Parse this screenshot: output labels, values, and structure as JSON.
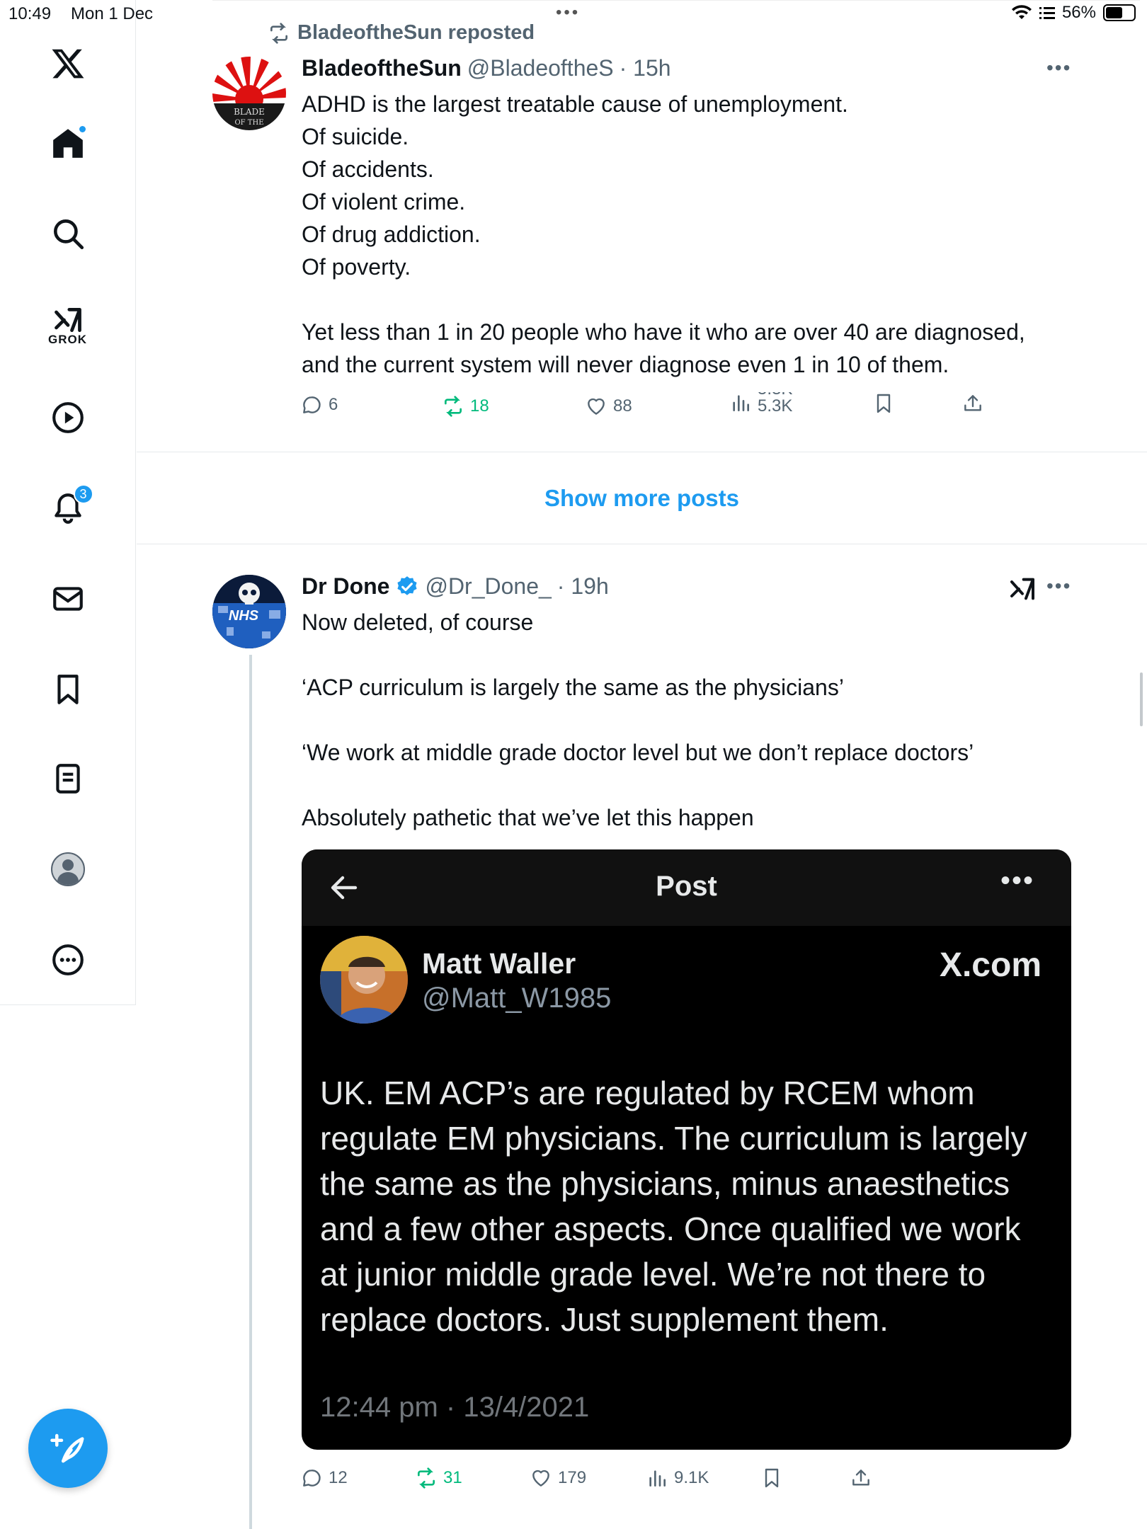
{
  "status_bar": {
    "time": "10:49",
    "date": "Mon 1 Dec",
    "battery": "56%"
  },
  "sidebar": {
    "grok_label": "GROK",
    "notifications_count": "3"
  },
  "post1": {
    "repost_label": "BladeoftheSun reposted",
    "name": "BladeoftheSun",
    "handle": "@BladeoftheS",
    "time": "· 15h",
    "lines": [
      "ADHD is the largest treatable cause of unemployment.",
      "Of suicide.",
      "Of accidents.",
      "Of violent crime.",
      "Of drug addiction.",
      "Of poverty.",
      "",
      "Yet less than 1 in 20 people who have it who are over 40 are diagnosed,",
      "and the current system will never diagnose even 1 in 10 of them."
    ],
    "replies": "6",
    "reposts": "18",
    "likes": "88",
    "views_old": "5.3K",
    "views_new": "5.3K"
  },
  "show_more": "Show more posts",
  "post2": {
    "name": "Dr Done",
    "handle": "@Dr_Done_",
    "time": "· 19h",
    "lines": [
      "Now deleted, of course",
      "",
      "‘ACP curriculum is largely the same as the physicians’",
      "",
      "‘We work at middle grade doctor level but we don’t replace doctors’",
      "",
      "Absolutely pathetic that we’ve let this happen"
    ],
    "replies": "12",
    "reposts": "31",
    "likes": "179",
    "views": "9.1K"
  },
  "embed": {
    "bar_title": "Post",
    "name": "Matt Waller",
    "handle": "@Matt_W1985",
    "brand": "X.com",
    "text_lines": [
      "UK. EM ACP’s are regulated by RCEM whom",
      "regulate EM physicians. The curriculum is largely",
      "the same as the physicians, minus anaesthetics",
      "and a few other aspects. Once qualified we work",
      "at junior middle grade level. We’re not there to",
      "replace doctors. Just supplement them."
    ],
    "timestamp": "12:44 pm · 13/4/2021"
  },
  "colors": {
    "accent": "#1d9bf0",
    "repost_green": "#00ba7c",
    "secondary_text": "#536471"
  }
}
